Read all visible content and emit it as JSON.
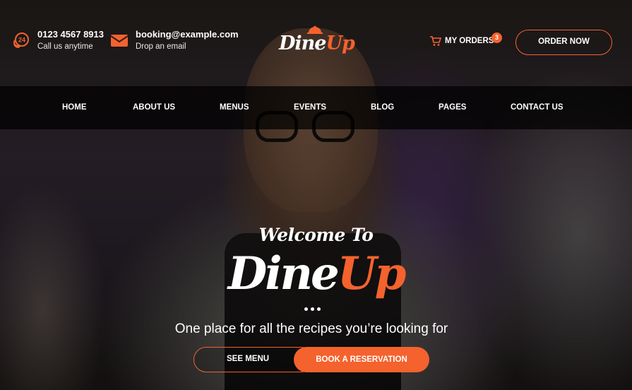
{
  "brand": {
    "name_part1": "Dine",
    "name_part2": "Up",
    "accent_color": "#f4622e"
  },
  "header": {
    "phone": {
      "icon": "phone-24-icon",
      "number": "0123 4567 8913",
      "caption": "Call us anytime"
    },
    "email": {
      "icon": "envelope-icon",
      "address": "booking@example.com",
      "caption": "Drop an email"
    },
    "my_orders": {
      "icon": "cart-icon",
      "label": "MY ORDERS",
      "count": "3"
    },
    "order_button": "ORDER NOW"
  },
  "nav": {
    "items": [
      {
        "label": "HOME"
      },
      {
        "label": "ABOUT US"
      },
      {
        "label": "MENUS"
      },
      {
        "label": "EVENTS"
      },
      {
        "label": "BLOG"
      },
      {
        "label": "PAGES"
      },
      {
        "label": "CONTACT US"
      }
    ]
  },
  "hero": {
    "welcome": "Welcome To",
    "title_part1": "Dine",
    "title_part2": "Up",
    "tagline": "One place for all the recipes you’re looking for",
    "see_menu_button": "SEE MENU",
    "reservation_button": "BOOK A RESERVATION"
  }
}
